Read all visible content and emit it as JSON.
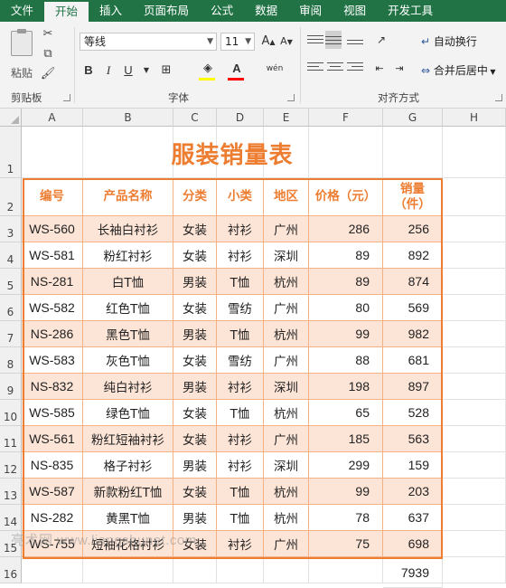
{
  "ribbon_tabs": [
    "文件",
    "开始",
    "插入",
    "页面布局",
    "公式",
    "数据",
    "审阅",
    "视图",
    "开发工具"
  ],
  "active_tab": "开始",
  "clipboard": {
    "paste_label": "粘贴",
    "group_label": "剪贴板"
  },
  "font_group": {
    "font_name": "等线",
    "font_size": "11",
    "group_label": "字体",
    "bold": "B",
    "italic": "I",
    "underline": "U",
    "grow": "A",
    "shrink": "A",
    "font_color": "A",
    "phonetic": "wén"
  },
  "align_group": {
    "wrap_text": "自动换行",
    "merge_center": "合并后居中",
    "group_label": "对齐方式"
  },
  "colors": {
    "accent": "#217346",
    "title_orange": "#ed7d31",
    "band": "#fce4d6",
    "border": "#f4b183"
  },
  "columns": [
    "A",
    "B",
    "C",
    "D",
    "E",
    "F",
    "G",
    "H"
  ],
  "rows": [
    "1",
    "2",
    "3",
    "4",
    "5",
    "6",
    "7",
    "8",
    "9",
    "10",
    "11",
    "12",
    "13",
    "14",
    "15",
    "16"
  ],
  "sheet": {
    "title": "服装销量表",
    "headers": [
      "编号",
      "产品名称",
      "分类",
      "小类",
      "地区",
      "价格（元）",
      "销量\n（件）"
    ],
    "records": [
      [
        "WS-560",
        "长袖白衬衫",
        "女装",
        "衬衫",
        "广州",
        "286",
        "256"
      ],
      [
        "WS-581",
        "粉红衬衫",
        "女装",
        "衬衫",
        "深圳",
        "89",
        "892"
      ],
      [
        "NS-281",
        "白T恤",
        "男装",
        "T恤",
        "杭州",
        "89",
        "874"
      ],
      [
        "WS-582",
        "红色T恤",
        "女装",
        "雪纺",
        "广州",
        "80",
        "569"
      ],
      [
        "NS-286",
        "黑色T恤",
        "男装",
        "T恤",
        "杭州",
        "99",
        "982"
      ],
      [
        "WS-583",
        "灰色T恤",
        "女装",
        "雪纺",
        "广州",
        "88",
        "681"
      ],
      [
        "NS-832",
        "纯白衬衫",
        "男装",
        "衬衫",
        "深圳",
        "198",
        "897"
      ],
      [
        "WS-585",
        "绿色T恤",
        "女装",
        "T恤",
        "杭州",
        "65",
        "528"
      ],
      [
        "WS-561",
        "粉红短袖衬衫",
        "女装",
        "衬衫",
        "广州",
        "185",
        "563"
      ],
      [
        "NS-835",
        "格子衬衫",
        "男装",
        "衬衫",
        "深圳",
        "299",
        "159"
      ],
      [
        "WS-587",
        "新款粉红T恤",
        "女装",
        "T恤",
        "杭州",
        "99",
        "203"
      ],
      [
        "NS-282",
        "黄黑T恤",
        "男装",
        "T恤",
        "杭州",
        "78",
        "637"
      ],
      [
        "WS-755",
        "短袖花格衬衫",
        "女装",
        "衬衫",
        "广州",
        "75",
        "698"
      ]
    ],
    "total_sales": "7939"
  },
  "watermark": "亮术网 www.liangshunet.com"
}
